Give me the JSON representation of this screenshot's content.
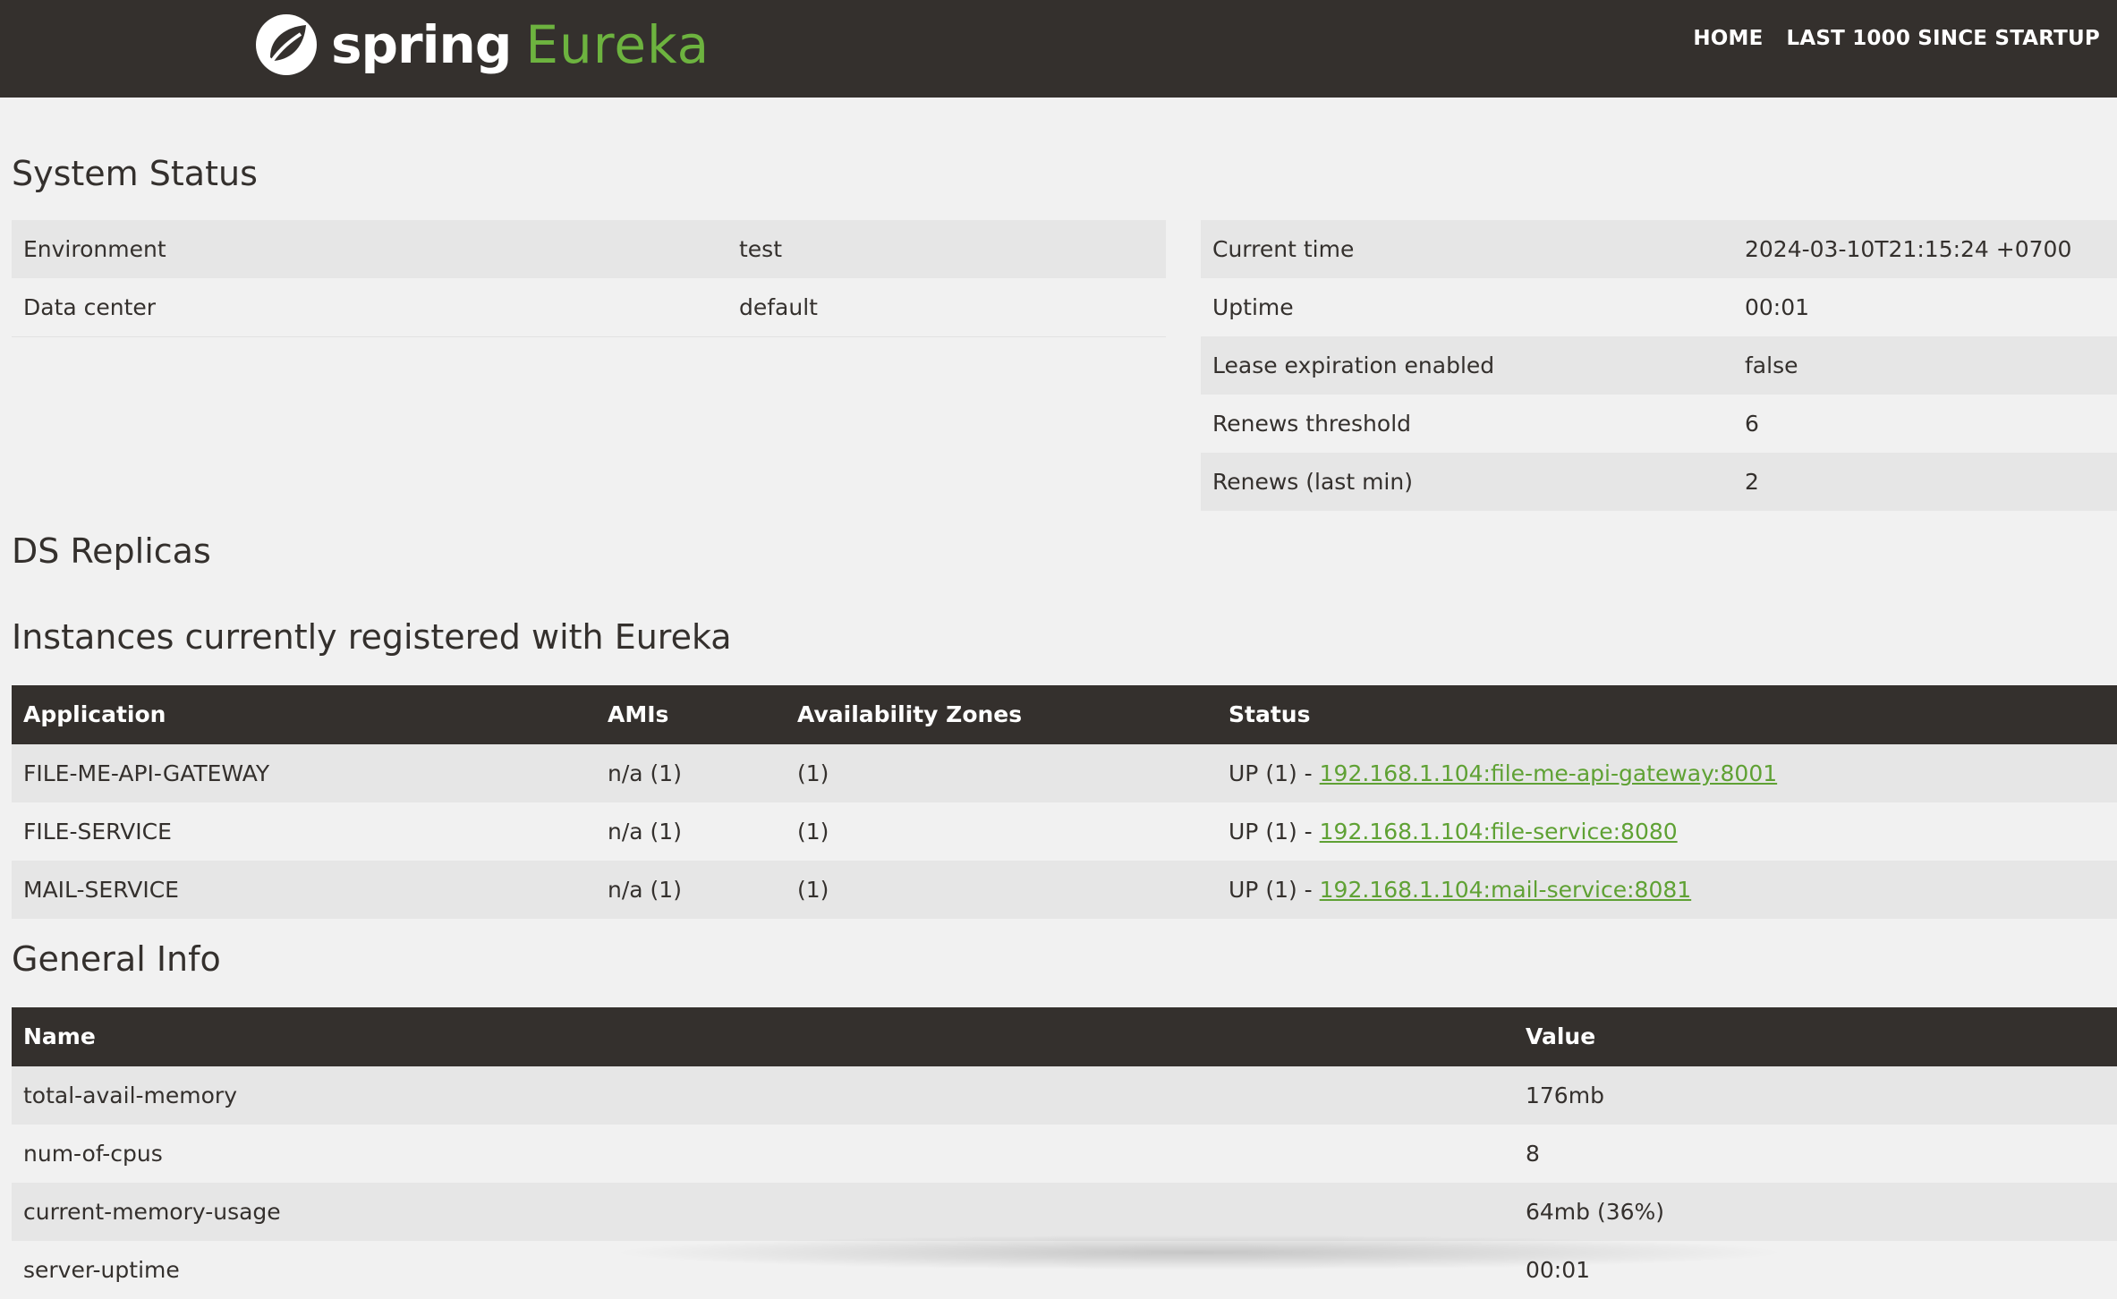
{
  "navbar": {
    "brand_spring": "spring",
    "brand_eureka": "Eureka",
    "logo_icon": "spring-leaf-icon",
    "links": [
      {
        "label": "HOME"
      },
      {
        "label": "LAST 1000 SINCE STARTUP"
      }
    ]
  },
  "system_status": {
    "title": "System Status",
    "left": [
      {
        "label": "Environment",
        "value": "test"
      },
      {
        "label": "Data center",
        "value": "default"
      }
    ],
    "right": [
      {
        "label": "Current time",
        "value": "2024-03-10T21:15:24 +0700"
      },
      {
        "label": "Uptime",
        "value": "00:01"
      },
      {
        "label": "Lease expiration enabled",
        "value": "false"
      },
      {
        "label": "Renews threshold",
        "value": "6"
      },
      {
        "label": "Renews (last min)",
        "value": "2"
      }
    ]
  },
  "ds_replicas": {
    "title": "DS Replicas"
  },
  "instances": {
    "title": "Instances currently registered with Eureka",
    "headers": [
      "Application",
      "AMIs",
      "Availability Zones",
      "Status"
    ],
    "rows": [
      {
        "application": "FILE-ME-API-GATEWAY",
        "amis": "n/a (1)",
        "zones": "(1)",
        "status_prefix": "UP (1) - ",
        "link": "192.168.1.104:file-me-api-gateway:8001"
      },
      {
        "application": "FILE-SERVICE",
        "amis": "n/a (1)",
        "zones": "(1)",
        "status_prefix": "UP (1) - ",
        "link": "192.168.1.104:file-service:8080"
      },
      {
        "application": "MAIL-SERVICE",
        "amis": "n/a (1)",
        "zones": "(1)",
        "status_prefix": "UP (1) - ",
        "link": "192.168.1.104:mail-service:8081"
      }
    ]
  },
  "general_info": {
    "title": "General Info",
    "headers": [
      "Name",
      "Value"
    ],
    "rows": [
      {
        "name": "total-avail-memory",
        "value": "176mb"
      },
      {
        "name": "num-of-cpus",
        "value": "8"
      },
      {
        "name": "current-memory-usage",
        "value": "64mb (36%)"
      },
      {
        "name": "server-uptime",
        "value": "00:01"
      }
    ]
  },
  "colors": {
    "navbar_bg": "#34302d",
    "accent_green": "#6db33f",
    "page_bg": "#f1f1f1",
    "row_stripe": "#e6e6e6"
  }
}
